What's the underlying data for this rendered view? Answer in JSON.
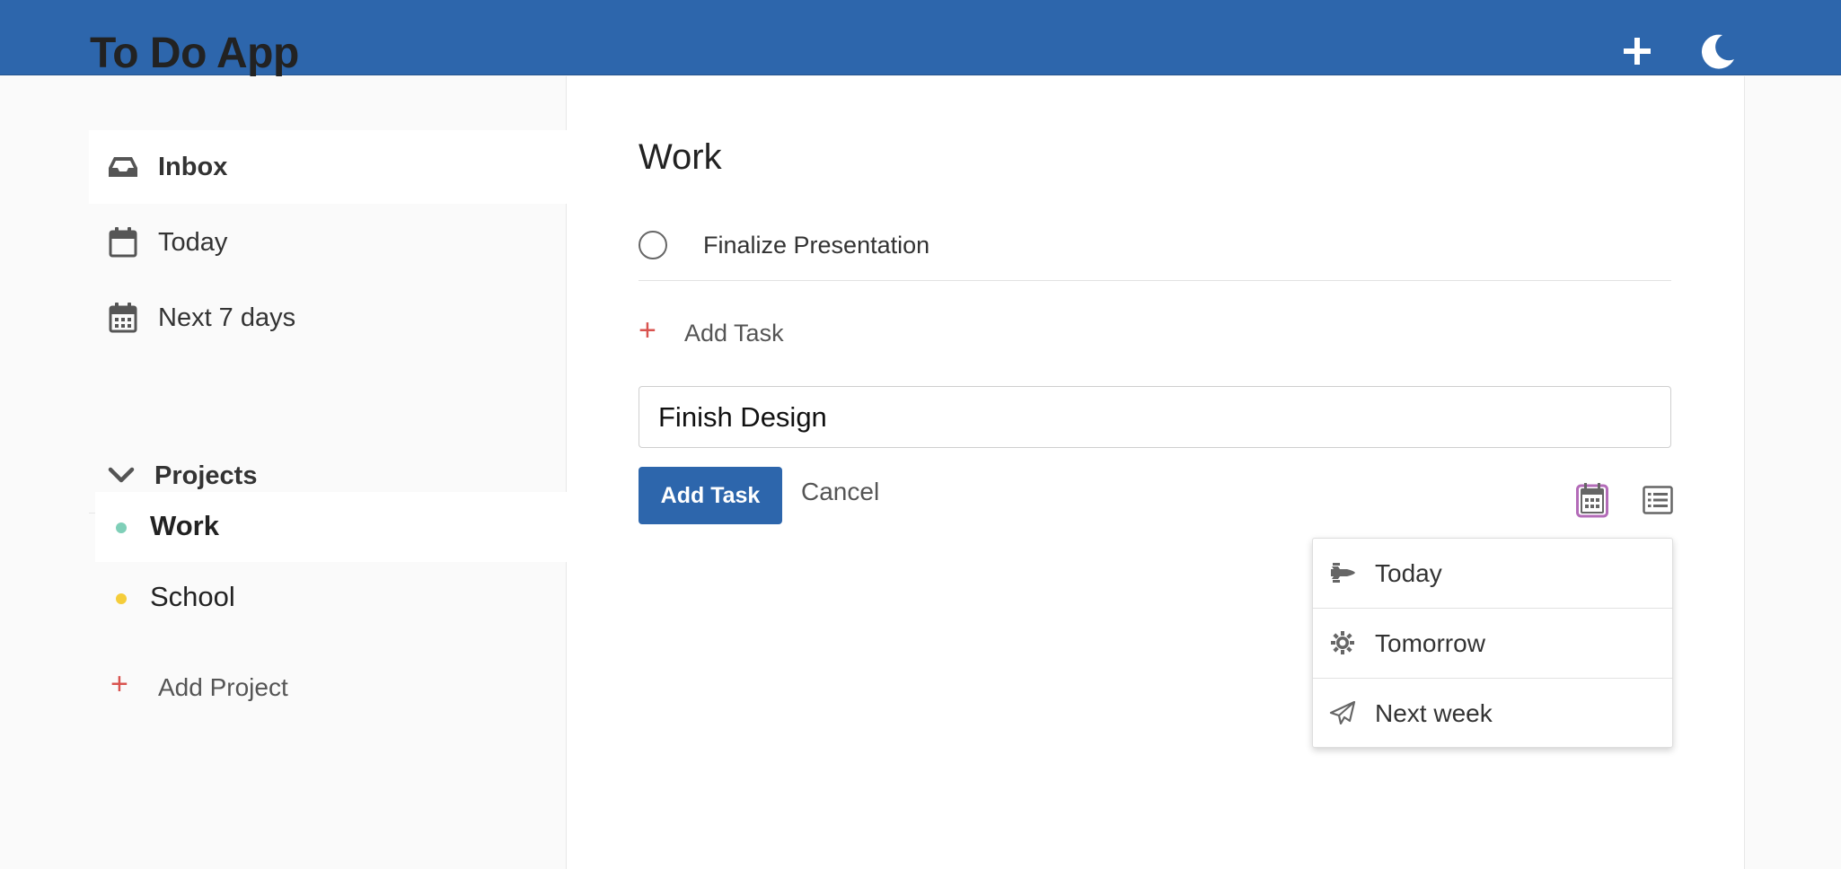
{
  "header": {
    "app_title": "To Do App",
    "add_icon": "plus-icon",
    "theme_icon": "moon-icon",
    "bg_color": "#2d66ac"
  },
  "sidebar": {
    "nav": [
      {
        "label": "Inbox",
        "icon": "inbox-icon",
        "active": true
      },
      {
        "label": "Today",
        "icon": "calendar-icon",
        "active": false
      },
      {
        "label": "Next 7 days",
        "icon": "calendar-grid-icon",
        "active": false
      }
    ],
    "projects_label": "Projects",
    "projects": [
      {
        "label": "Work",
        "color": "#7fcfb8",
        "active": true
      },
      {
        "label": "School",
        "color": "#f5cd3a",
        "active": false
      }
    ],
    "add_project_plus": "+",
    "add_project_label": "Add Project"
  },
  "main": {
    "title": "Work",
    "tasks": [
      {
        "name": "Finalize Presentation",
        "done": false
      }
    ],
    "add_task_plus": "+",
    "add_task_label": "Add Task",
    "task_input_value": "Finish Design",
    "add_button_label": "Add Task",
    "cancel_label": "Cancel",
    "date_tool_icon": "calendar-icon",
    "list_tool_icon": "list-icon",
    "accent_color": "#2d66ac",
    "add_plus_color": "#d9534f"
  },
  "date_menu": {
    "items": [
      {
        "label": "Today",
        "icon": "space-shuttle-icon"
      },
      {
        "label": "Tomorrow",
        "icon": "sun-icon"
      },
      {
        "label": "Next week",
        "icon": "paper-plane-icon"
      }
    ]
  }
}
